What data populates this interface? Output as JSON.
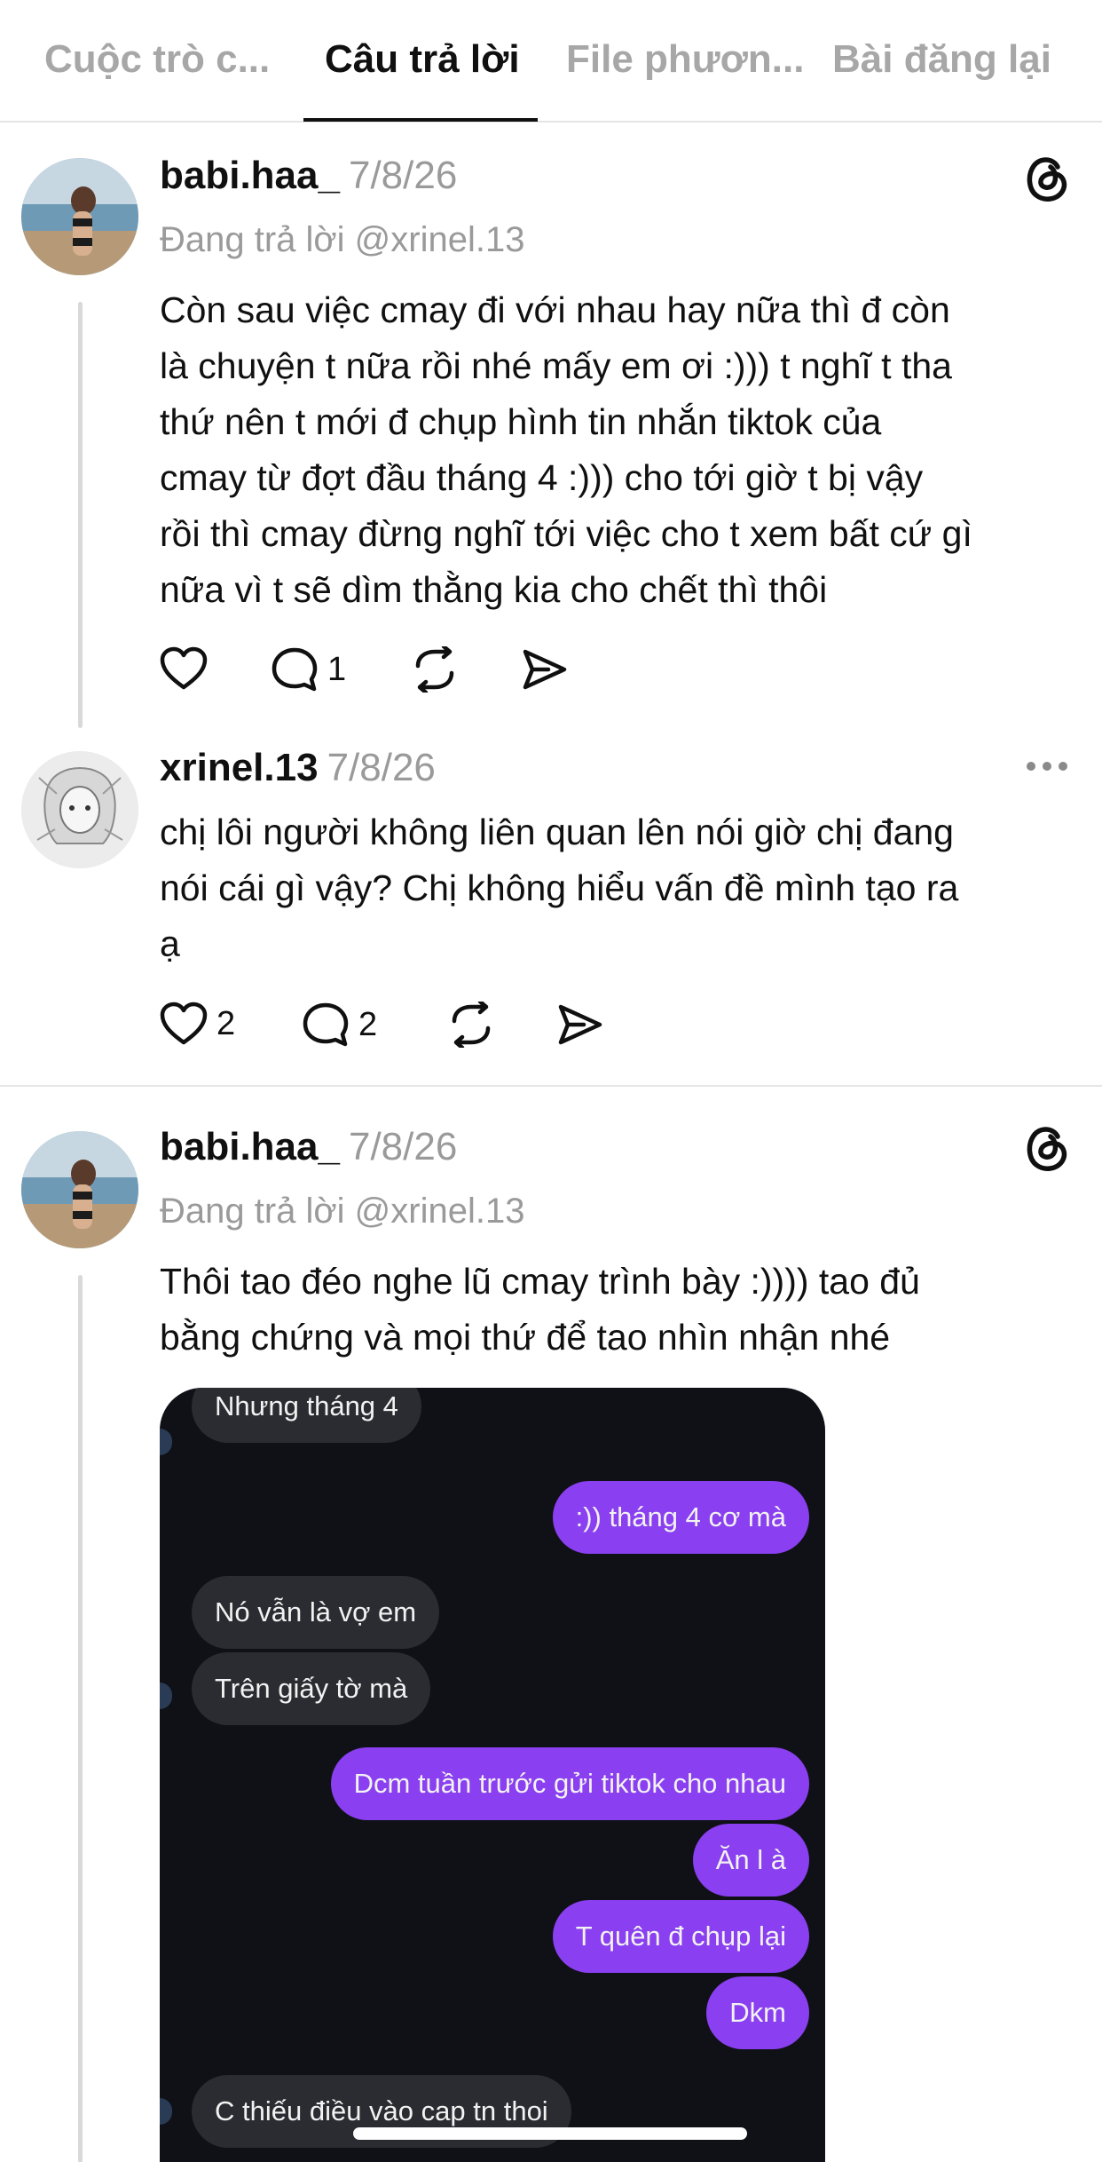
{
  "tabs": [
    {
      "label": "Cuộc trò c...",
      "active": false
    },
    {
      "label": "Câu trả lời",
      "active": true
    },
    {
      "label": "File phươn...",
      "active": false
    },
    {
      "label": "Bài đăng lại",
      "active": false
    }
  ],
  "posts": [
    {
      "username": "babi.haa_",
      "date": "7/8/26",
      "reply_to": "Đang trả lời @xrinel.13",
      "text_lines": [
        "Còn sau việc cmay đi với nhau hay nữa thì đ còn",
        "là chuyện t nữa rồi nhé mấy em ơi :))) t nghĩ t tha",
        "thứ nên t mới đ chụp hình tin nhắn tiktok của",
        "cmay từ đợt đầu tháng 4 :))) cho tới giờ t bị vậy",
        "rồi thì cmay đừng nghĩ tới việc cho t xem bất cứ gì",
        "nữa vì t sẽ dìm thằng kia cho chết thì thôi"
      ],
      "likes": "",
      "replies": "1",
      "corner_icon": "threads-logo-icon"
    },
    {
      "username": "xrinel.13",
      "date": "7/8/26",
      "text_lines": [
        "chị lôi người không liên quan lên nói giờ chị đang",
        "nói cái gì vậy? Chị không hiểu vấn đề mình tạo ra",
        "ạ"
      ],
      "likes": "2",
      "replies": "2",
      "corner_icon": "more-options-icon"
    },
    {
      "username": "babi.haa_",
      "date": "7/8/26",
      "reply_to": "Đang trả lời @xrinel.13",
      "text_lines": [
        "Thôi tao đéo nghe lũ cmay trình bày :)))) tao đủ",
        "bằng chứng và mọi thứ để tao nhìn nhận nhé"
      ],
      "corner_icon": "threads-logo-icon"
    }
  ],
  "chat_screenshot": {
    "messages": [
      {
        "side": "in",
        "text": "Nhưng tháng 4"
      },
      {
        "side": "out",
        "text": ":)) tháng 4 cơ mà"
      },
      {
        "side": "in",
        "text": "Nó vẫn là vợ em"
      },
      {
        "side": "in",
        "text": "Trên giấy tờ mà"
      },
      {
        "side": "out",
        "text": "Dcm tuần trước gửi tiktok cho nhau"
      },
      {
        "side": "out",
        "text": "Ăn l à"
      },
      {
        "side": "out",
        "text": "T quên đ chụp lại"
      },
      {
        "side": "out",
        "text": "Dkm"
      },
      {
        "side": "in",
        "text": "C thiếu điều vào cap tn thoi"
      }
    ],
    "colors": {
      "background": "#0f1116",
      "incoming": "#2b2c31",
      "outgoing": "#8a3ff0"
    }
  }
}
